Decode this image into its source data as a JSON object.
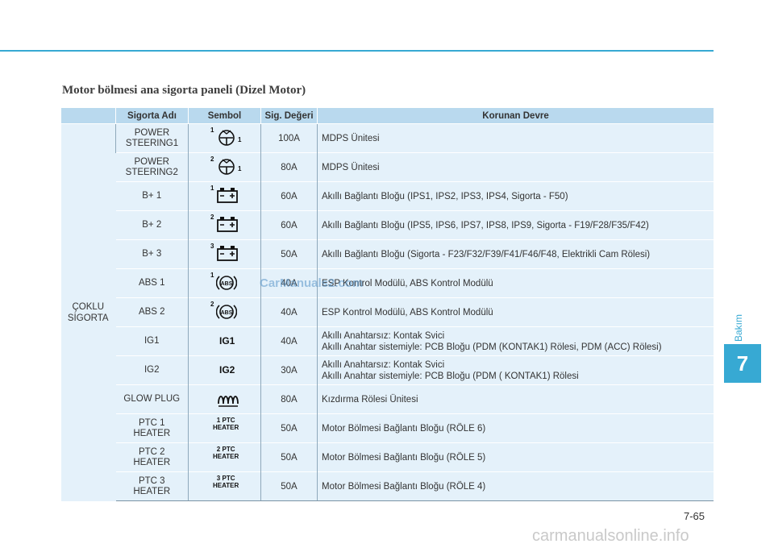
{
  "title": "Motor bölmesi ana sigorta paneli (Dizel Motor)",
  "headers": [
    "Sigorta Adı",
    "Sembol",
    "Sig. Değeri",
    "Korunan Devre"
  ],
  "group_label": [
    "ÇOKLU",
    "SİGORTA"
  ],
  "rows": [
    {
      "name": [
        "POWER",
        "STEERING1"
      ],
      "symbol": "steering-icon",
      "sym_pre": "1",
      "sym_post": "1",
      "value": "100A",
      "desc": [
        "MDPS Ünitesi"
      ]
    },
    {
      "name": [
        "POWER",
        "STEERING2"
      ],
      "symbol": "steering-icon",
      "sym_pre": "2",
      "sym_post": "1",
      "value": "80A",
      "desc": [
        "MDPS Ünitesi"
      ]
    },
    {
      "name": [
        "B+ 1"
      ],
      "symbol": "battery-icon",
      "sym_pre": "1",
      "value": "60A",
      "desc": [
        "Akıllı Bağlantı Bloğu (IPS1, IPS2, IPS3, IPS4, Sigorta - F50)"
      ]
    },
    {
      "name": [
        "B+ 2"
      ],
      "symbol": "battery-icon",
      "sym_pre": "2",
      "value": "60A",
      "desc": [
        "Akıllı Bağlantı Bloğu (IPS5, IPS6, IPS7, IPS8, IPS9, Sigorta - F19/F28/F35/F42)"
      ]
    },
    {
      "name": [
        "B+ 3"
      ],
      "symbol": "battery-icon",
      "sym_pre": "3",
      "value": "50A",
      "desc": [
        "Akıllı Bağlantı Bloğu (Sigorta - F23/F32/F39/F41/F46/F48, Elektrikli Cam Rölesi)"
      ]
    },
    {
      "name": [
        "ABS 1"
      ],
      "symbol": "abs-icon",
      "sym_pre": "1",
      "value": "40A",
      "desc": [
        "ESP Kontrol Modülü, ABS Kontrol Modülü"
      ]
    },
    {
      "name": [
        "ABS 2"
      ],
      "symbol": "abs-icon",
      "sym_pre": "2",
      "value": "40A",
      "desc": [
        "ESP Kontrol Modülü, ABS Kontrol Modülü"
      ]
    },
    {
      "name": [
        "IG1"
      ],
      "symbol": "ig-icon",
      "sym_text": "IG1",
      "value": "40A",
      "desc": [
        "Akıllı Anahtarsız: Kontak Svici",
        "Akıllı Anahtar sistemiyle: PCB Bloğu (PDM (KONTAK1) Rölesi, PDM (ACC) Rölesi)"
      ]
    },
    {
      "name": [
        "IG2"
      ],
      "symbol": "ig-icon",
      "sym_text": "IG2",
      "value": "30A",
      "desc": [
        "Akıllı Anahtarsız: Kontak Svici",
        "Akıllı Anahtar sistemiyle: PCB Bloğu (PDM ( KONTAK1) Rölesi"
      ]
    },
    {
      "name": [
        "GLOW PLUG"
      ],
      "symbol": "glow-plug-icon",
      "value": "80A",
      "desc": [
        "Kızdırma Rölesi Ünitesi"
      ]
    },
    {
      "name": [
        "PTC 1",
        "HEATER"
      ],
      "symbol": "ptc-icon",
      "sym_pre": "1",
      "sym_text": "PTC",
      "sym_text2": "HEATER",
      "value": "50A",
      "desc": [
        "Motor Bölmesi Bağlantı Bloğu (RÖLE 6)"
      ]
    },
    {
      "name": [
        "PTC 2",
        "HEATER"
      ],
      "symbol": "ptc-icon",
      "sym_pre": "2",
      "sym_text": "PTC",
      "sym_text2": "HEATER",
      "value": "50A",
      "desc": [
        "Motor Bölmesi Bağlantı Bloğu (RÖLE 5)"
      ]
    },
    {
      "name": [
        "PTC 3",
        "HEATER"
      ],
      "symbol": "ptc-icon",
      "sym_pre": "3",
      "sym_text": "PTC",
      "sym_text2": "HEATER",
      "value": "50A",
      "desc": [
        "Motor Bölmesi Bağlantı Bloğu (RÖLE 4)"
      ]
    }
  ],
  "sidebar": {
    "label": "Bakım",
    "chapter": "7"
  },
  "page_number": "7-65",
  "watermarks": {
    "middle": "CarManuals2.com",
    "bottom": "carmanualsonline.info"
  },
  "colors": {
    "accent": "#37a9d3",
    "header_bg": "#b9d9ee",
    "row_bg": "#e4f1fa"
  }
}
